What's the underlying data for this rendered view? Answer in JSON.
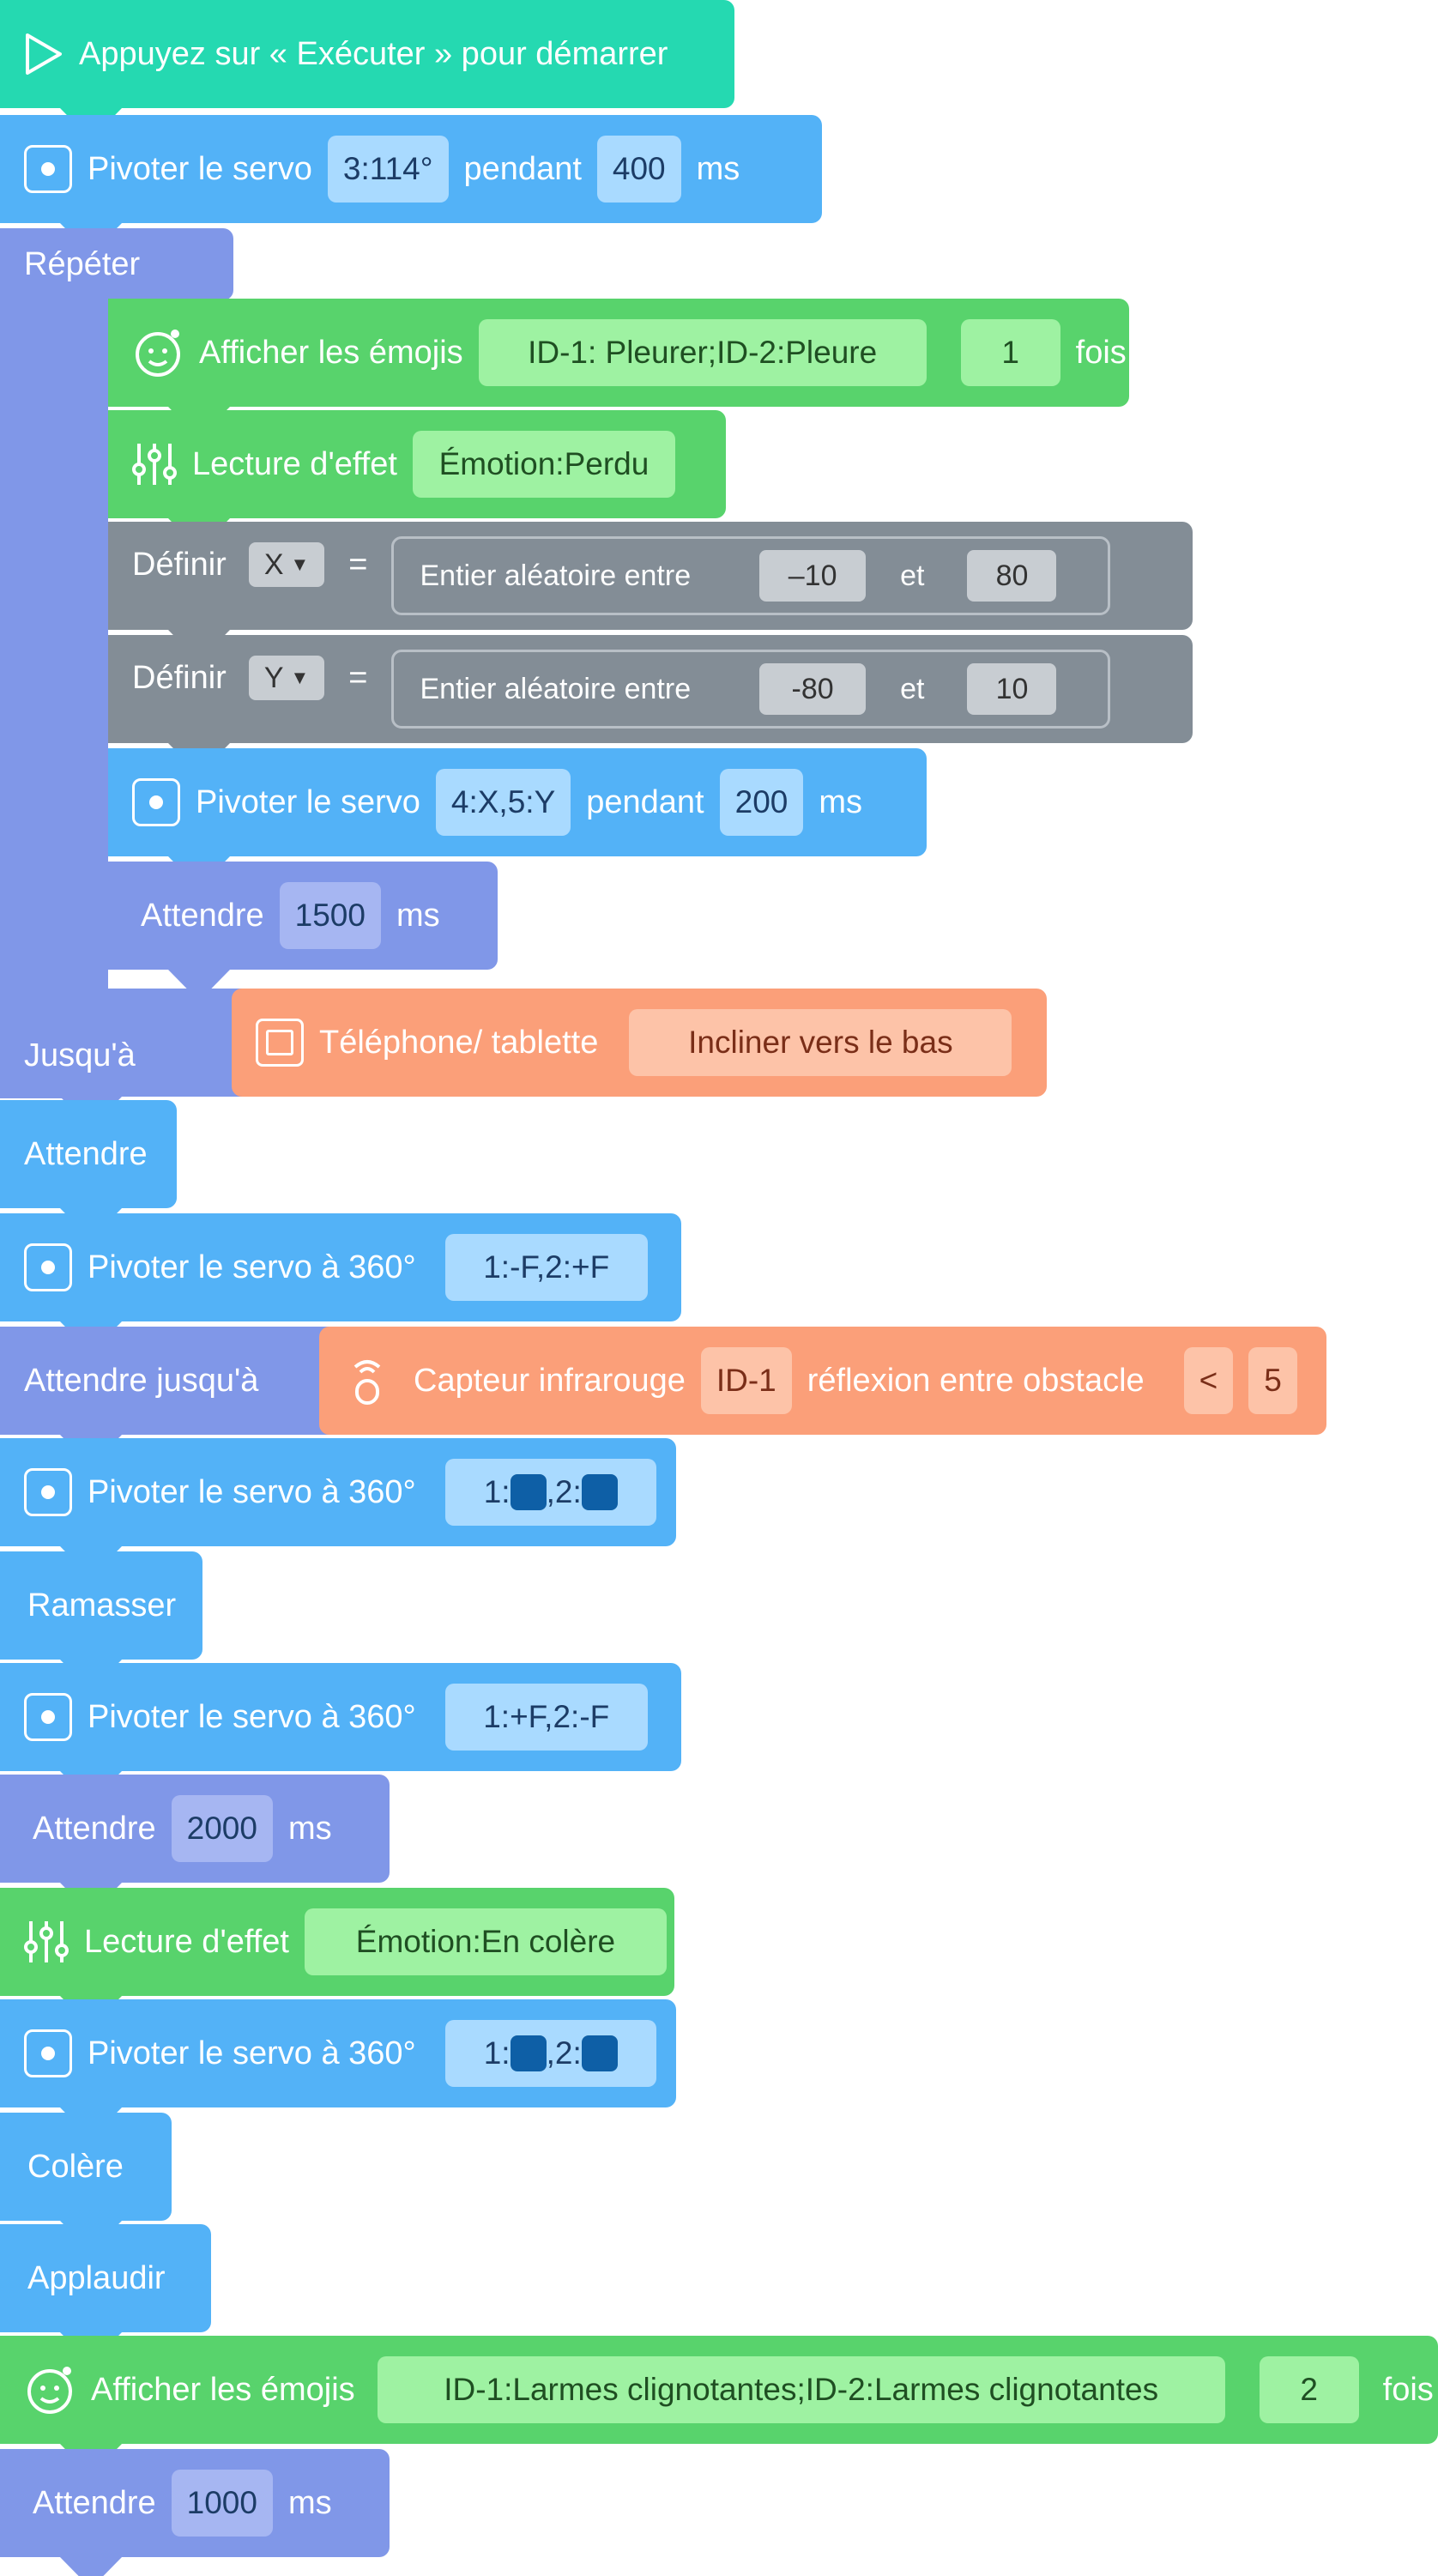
{
  "start": "Appuyez sur « Exécuter » pour démarrer",
  "blocks": {
    "b1": {
      "label": "Pivoter le servo",
      "arg": "3:114°",
      "mid": "pendant",
      "val": "400",
      "unit": "ms"
    },
    "repeat": {
      "label": "Répéter",
      "until": "Jusqu'à"
    },
    "emoji1": {
      "label": "Afficher les émojis",
      "arg": "ID-1: Pleurer;ID-2:Pleure",
      "val": "1",
      "unit": "fois"
    },
    "effect1": {
      "label": "Lecture d'effet",
      "arg": "Émotion:Perdu"
    },
    "setx": {
      "label": "Définir",
      "var": "X",
      "eq": "=",
      "rand": "Entier aléatoire entre",
      "a": "–10",
      "and": "et",
      "b": "80"
    },
    "sety": {
      "label": "Définir",
      "var": "Y",
      "eq": "=",
      "rand": "Entier aléatoire entre",
      "a": "-80",
      "and": "et",
      "b": "10"
    },
    "servo2": {
      "label": "Pivoter le servo",
      "arg": "4:X,5:Y",
      "mid": "pendant",
      "val": "200",
      "unit": "ms"
    },
    "wait1": {
      "label": "Attendre",
      "val": "1500",
      "unit": "ms"
    },
    "phone": {
      "label": "Téléphone/ tablette",
      "arg": "Incliner vers le bas"
    },
    "wait2": {
      "label": "Attendre"
    },
    "s360a": {
      "label": "Pivoter le servo à 360°",
      "arg": "1:-F,2:+F"
    },
    "waituntil": {
      "label": "Attendre jusqu'à",
      "sensor": "Capteur infrarouge",
      "id": "ID-1",
      "text": "réflexion entre obstacle",
      "op": "<",
      "val": "5"
    },
    "s360b": {
      "label": "Pivoter le servo à 360°",
      "p1": "1:",
      "p2": ",2:"
    },
    "pick": {
      "label": "Ramasser"
    },
    "s360c": {
      "label": "Pivoter le servo à 360°",
      "arg": "1:+F,2:-F"
    },
    "wait3": {
      "label": "Attendre",
      "val": "2000",
      "unit": "ms"
    },
    "effect2": {
      "label": "Lecture d'effet",
      "arg": "Émotion:En colère"
    },
    "s360d": {
      "label": "Pivoter le servo à 360°",
      "p1": "1:",
      "p2": ",2:"
    },
    "anger": {
      "label": "Colère"
    },
    "clap": {
      "label": "Applaudir"
    },
    "emoji2": {
      "label": "Afficher les émojis",
      "arg": "ID-1:Larmes clignotantes;ID-2:Larmes clignotantes",
      "val": "2",
      "unit": "fois"
    },
    "wait4": {
      "label": "Attendre",
      "val": "1000",
      "unit": "ms"
    }
  },
  "colors": {
    "teal": "#25d9b1",
    "blue": "#53b2f7",
    "purple": "#8097e8",
    "green": "#58d36c",
    "gray": "#838d96",
    "orange": "#fb9f79"
  }
}
